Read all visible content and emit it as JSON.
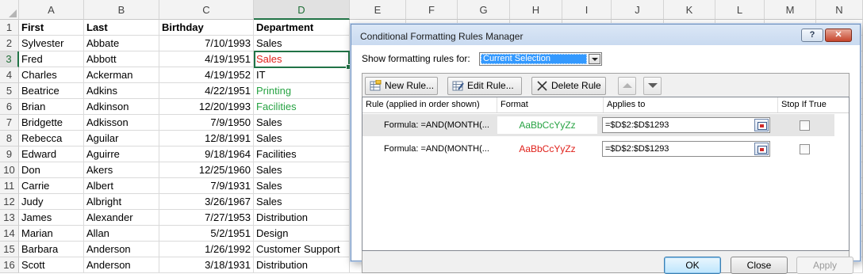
{
  "spreadsheet": {
    "columns": [
      "A",
      "B",
      "C",
      "D",
      "E",
      "F",
      "G",
      "H",
      "I",
      "J",
      "K",
      "L",
      "M",
      "N"
    ],
    "headers": {
      "first": "First",
      "last": "Last",
      "birthday": "Birthday",
      "department": "Department"
    },
    "rows": [
      {
        "n": "1"
      },
      {
        "n": "2",
        "first": "Sylvester",
        "last": "Abbate",
        "birthday": "7/10/1993",
        "department": "Sales",
        "dept_color": ""
      },
      {
        "n": "3",
        "first": "Fred",
        "last": "Abbott",
        "birthday": "4/19/1951",
        "department": "Sales",
        "dept_color": "red"
      },
      {
        "n": "4",
        "first": "Charles",
        "last": "Ackerman",
        "birthday": "4/19/1952",
        "department": "IT",
        "dept_color": ""
      },
      {
        "n": "5",
        "first": "Beatrice",
        "last": "Adkins",
        "birthday": "4/22/1951",
        "department": "Printing",
        "dept_color": "green"
      },
      {
        "n": "6",
        "first": "Brian",
        "last": "Adkinson",
        "birthday": "12/20/1993",
        "department": "Facilities",
        "dept_color": "green"
      },
      {
        "n": "7",
        "first": "Bridgette",
        "last": "Adkisson",
        "birthday": "7/9/1950",
        "department": "Sales",
        "dept_color": ""
      },
      {
        "n": "8",
        "first": "Rebecca",
        "last": "Aguilar",
        "birthday": "12/8/1991",
        "department": "Sales",
        "dept_color": ""
      },
      {
        "n": "9",
        "first": "Edward",
        "last": "Aguirre",
        "birthday": "9/18/1964",
        "department": "Facilities",
        "dept_color": ""
      },
      {
        "n": "10",
        "first": "Don",
        "last": "Akers",
        "birthday": "12/25/1960",
        "department": "Sales",
        "dept_color": ""
      },
      {
        "n": "11",
        "first": "Carrie",
        "last": "Albert",
        "birthday": "7/9/1931",
        "department": "Sales",
        "dept_color": ""
      },
      {
        "n": "12",
        "first": "Judy",
        "last": "Albright",
        "birthday": "3/26/1967",
        "department": "Sales",
        "dept_color": ""
      },
      {
        "n": "13",
        "first": "James",
        "last": "Alexander",
        "birthday": "7/27/1953",
        "department": "Distribution",
        "dept_color": ""
      },
      {
        "n": "14",
        "first": "Marian",
        "last": "Allan",
        "birthday": "5/2/1951",
        "department": "Design",
        "dept_color": ""
      },
      {
        "n": "15",
        "first": "Barbara",
        "last": "Anderson",
        "birthday": "1/26/1992",
        "department": "Customer Support",
        "dept_color": ""
      },
      {
        "n": "16",
        "first": "Scott",
        "last": "Anderson",
        "birthday": "3/18/1931",
        "department": "Distribution",
        "dept_color": ""
      }
    ],
    "colors": {
      "red": "#e0211b",
      "green": "#27a343",
      "selection": "#217346"
    }
  },
  "dialog": {
    "title": "Conditional Formatting Rules Manager",
    "help_label": "?",
    "close_label": "✕",
    "show_label": "Show formatting rules for:",
    "show_value": "Current Selection",
    "toolbar": {
      "new_rule": "New Rule...",
      "edit_rule": "Edit Rule...",
      "delete_rule": "Delete Rule",
      "move_up_icon": "arrow-up-icon",
      "move_down_icon": "arrow-down-icon"
    },
    "table_headers": {
      "rule": "Rule (applied in order shown)",
      "format": "Format",
      "applies": "Applies to",
      "stop": "Stop If True"
    },
    "rules": [
      {
        "formula": "Formula: =AND(MONTH(...",
        "sample": "AaBbCcYyZz",
        "sample_color": "#27a343",
        "applies_to": "=$D$2:$D$1293",
        "stop_if_true": false,
        "selected": true
      },
      {
        "formula": "Formula: =AND(MONTH(...",
        "sample": "AaBbCcYyZz",
        "sample_color": "#e0211b",
        "applies_to": "=$D$2:$D$1293",
        "stop_if_true": false,
        "selected": false
      }
    ],
    "buttons": {
      "ok": "OK",
      "close": "Close",
      "apply": "Apply"
    }
  }
}
